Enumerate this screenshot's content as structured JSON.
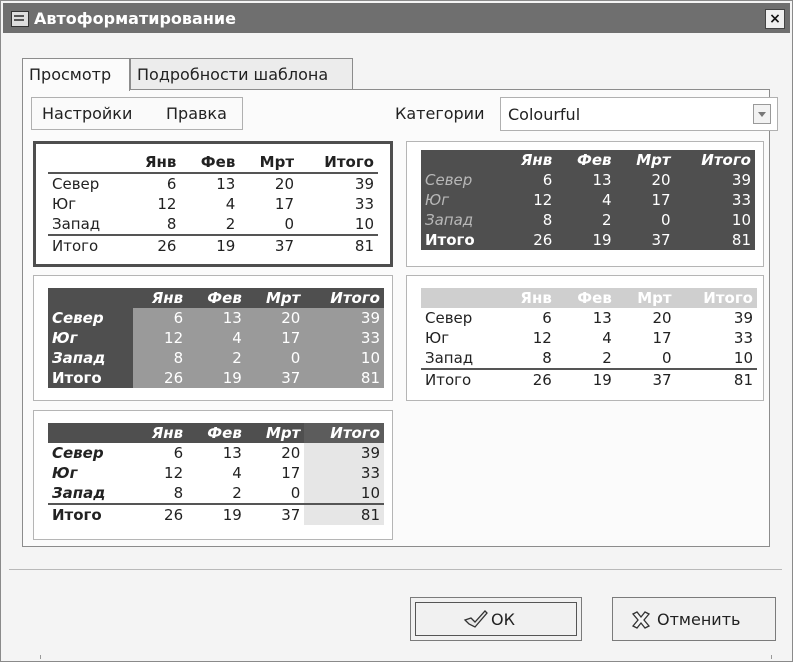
{
  "window": {
    "title": "Автоформатирование",
    "close": "×"
  },
  "tabs": [
    {
      "label": "Просмотр"
    },
    {
      "label": "Подробности шаблона"
    }
  ],
  "menu": {
    "settings": "Настройки",
    "edit": "Правка"
  },
  "category": {
    "label": "Категории",
    "value": "Colourful"
  },
  "sample_table": {
    "headers": [
      "",
      "Янв",
      "Фев",
      "Мрт",
      "Итого"
    ],
    "rows": [
      [
        "Север",
        "6",
        "13",
        "20",
        "39"
      ],
      [
        "Юг",
        "12",
        "4",
        "17",
        "33"
      ],
      [
        "Запад",
        "8",
        "2",
        "0",
        "10"
      ],
      [
        "Итого",
        "26",
        "19",
        "37",
        "81"
      ]
    ]
  },
  "buttons": {
    "ok": "ОК",
    "cancel": "Отменить"
  },
  "icons": {
    "ok": "checkmark-hand-icon",
    "cancel": "cross-icon"
  },
  "colors": {
    "titlebar": "#6f6f6f",
    "dark_header": "#4f4f4f",
    "mid_body": "#9a9a9a",
    "light_header": "#cfcfcf"
  }
}
